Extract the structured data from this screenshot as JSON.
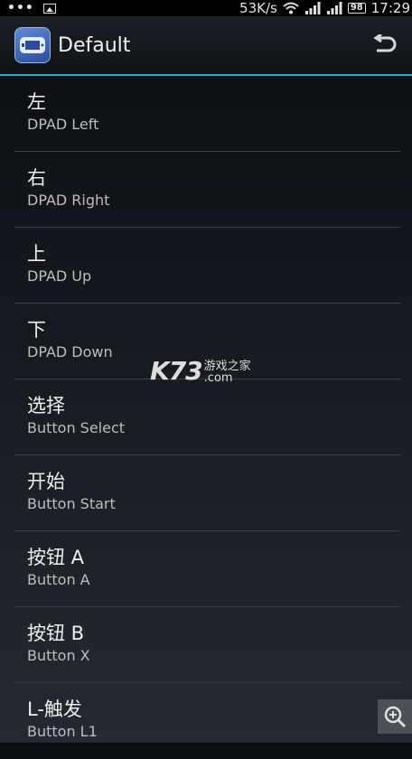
{
  "status_bar": {
    "overflow_dots": "•••",
    "network_speed": "53K/s",
    "battery_level": "98",
    "time": "17:29"
  },
  "action_bar": {
    "title": "Default"
  },
  "items": [
    {
      "title": "左",
      "subtitle": "DPAD Left"
    },
    {
      "title": "右",
      "subtitle": "DPAD Right"
    },
    {
      "title": "上",
      "subtitle": "DPAD Up"
    },
    {
      "title": "下",
      "subtitle": "DPAD Down"
    },
    {
      "title": "选择",
      "subtitle": "Button Select"
    },
    {
      "title": "开始",
      "subtitle": "Button Start"
    },
    {
      "title": "按钮 A",
      "subtitle": "Button A"
    },
    {
      "title": "按钮 B",
      "subtitle": "Button X"
    },
    {
      "title": "L-触发",
      "subtitle": "Button L1"
    }
  ],
  "watermark": {
    "brand": "K73",
    "cn_text": "游戏之家",
    "domain": ".com"
  },
  "colors": {
    "accent": "#3aa6c8",
    "background_top": "#0b0d10",
    "background_bottom": "#262a30"
  }
}
